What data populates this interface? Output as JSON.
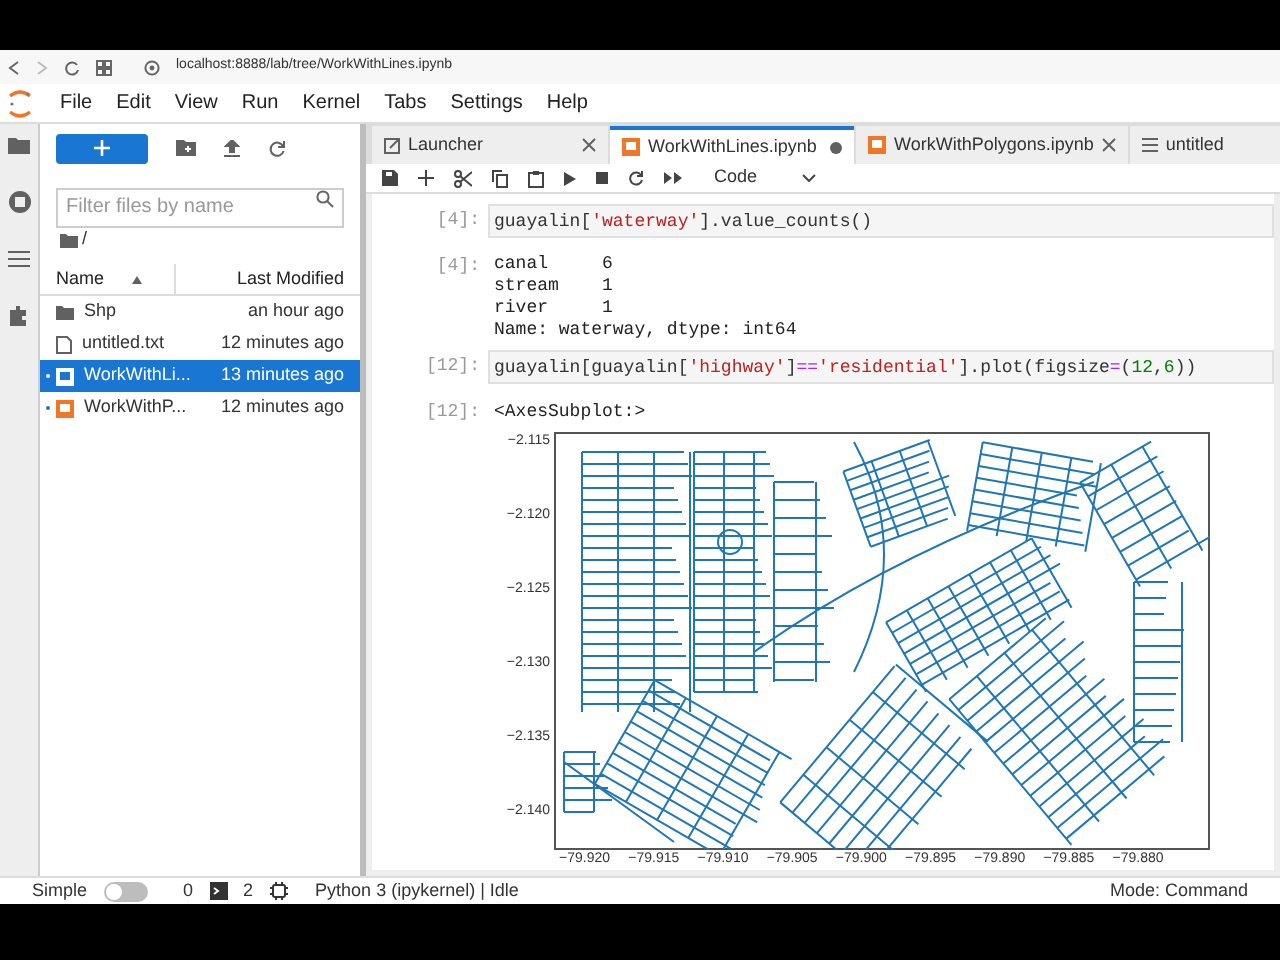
{
  "browser": {
    "url": "localhost:8888/lab/tree/WorkWithLines.ipynb"
  },
  "menu": [
    "File",
    "Edit",
    "View",
    "Run",
    "Kernel",
    "Tabs",
    "Settings",
    "Help"
  ],
  "file_browser": {
    "filter_placeholder": "Filter files by name",
    "path": "/",
    "columns": [
      "Name",
      "Last Modified"
    ],
    "files": [
      {
        "name": "Shp",
        "modified": "an hour ago",
        "kind": "folder",
        "selected": false,
        "running": false
      },
      {
        "name": "untitled.txt",
        "modified": "12 minutes ago",
        "kind": "text",
        "selected": false,
        "running": false
      },
      {
        "name": "WorkWithLi...",
        "modified": "13 minutes ago",
        "kind": "notebook",
        "selected": true,
        "running": true
      },
      {
        "name": "WorkWithP...",
        "modified": "12 minutes ago",
        "kind": "notebook",
        "selected": false,
        "running": true
      }
    ]
  },
  "tabs": [
    {
      "label": "Launcher",
      "kind": "launcher",
      "selected": false,
      "modified": false
    },
    {
      "label": "WorkWithLines.ipynb",
      "kind": "notebook",
      "selected": true,
      "modified": true
    },
    {
      "label": "WorkWithPolygons.ipynb",
      "kind": "notebook",
      "selected": false,
      "modified": false
    },
    {
      "label": "untitled",
      "kind": "text",
      "selected": false
    }
  ],
  "toolbar": {
    "cell_type": "Code"
  },
  "cells": [
    {
      "kind": "input",
      "prompt": "[4]:",
      "tokens": [
        {
          "text": "guayalin[",
          "kind": "plain"
        },
        {
          "text": "'waterway'",
          "kind": "string"
        },
        {
          "text": "].value_counts()",
          "kind": "plain"
        }
      ]
    },
    {
      "kind": "output",
      "prompt": "[4]:",
      "lines": [
        "canal     6",
        "stream    1",
        "river     1",
        "Name: waterway, dtype: int64"
      ]
    },
    {
      "kind": "input",
      "prompt": "[12]:",
      "tokens": [
        {
          "text": "guayalin[guayalin[",
          "kind": "plain"
        },
        {
          "text": "'highway'",
          "kind": "string"
        },
        {
          "text": "]",
          "kind": "plain"
        },
        {
          "text": "==",
          "kind": "operator"
        },
        {
          "text": "'residential'",
          "kind": "string"
        },
        {
          "text": "].plot(figsize",
          "kind": "plain"
        },
        {
          "text": "=",
          "kind": "operator"
        },
        {
          "text": "(",
          "kind": "plain"
        },
        {
          "text": "12",
          "kind": "number"
        },
        {
          "text": ",",
          "kind": "plain"
        },
        {
          "text": "6",
          "kind": "number"
        },
        {
          "text": "))",
          "kind": "plain"
        }
      ]
    },
    {
      "kind": "plot",
      "prompt": "[12]:",
      "text": "<AxesSubplot:>",
      "yticks": [
        "−2.115",
        "−2.120",
        "−2.125",
        "−2.130",
        "−2.135",
        "−2.140"
      ],
      "xticks": [
        "−79.920",
        "−79.915",
        "−79.910",
        "−79.905",
        "−79.900",
        "−79.895",
        "−79.890",
        "−79.885",
        "−79.880"
      ]
    }
  ],
  "status_bar": {
    "simple_label": "Simple",
    "simple_on": false,
    "terminals": "0",
    "kernels": "2",
    "kernel": "Python 3 (ipykernel) | Idle",
    "mode": "Mode: Command"
  }
}
